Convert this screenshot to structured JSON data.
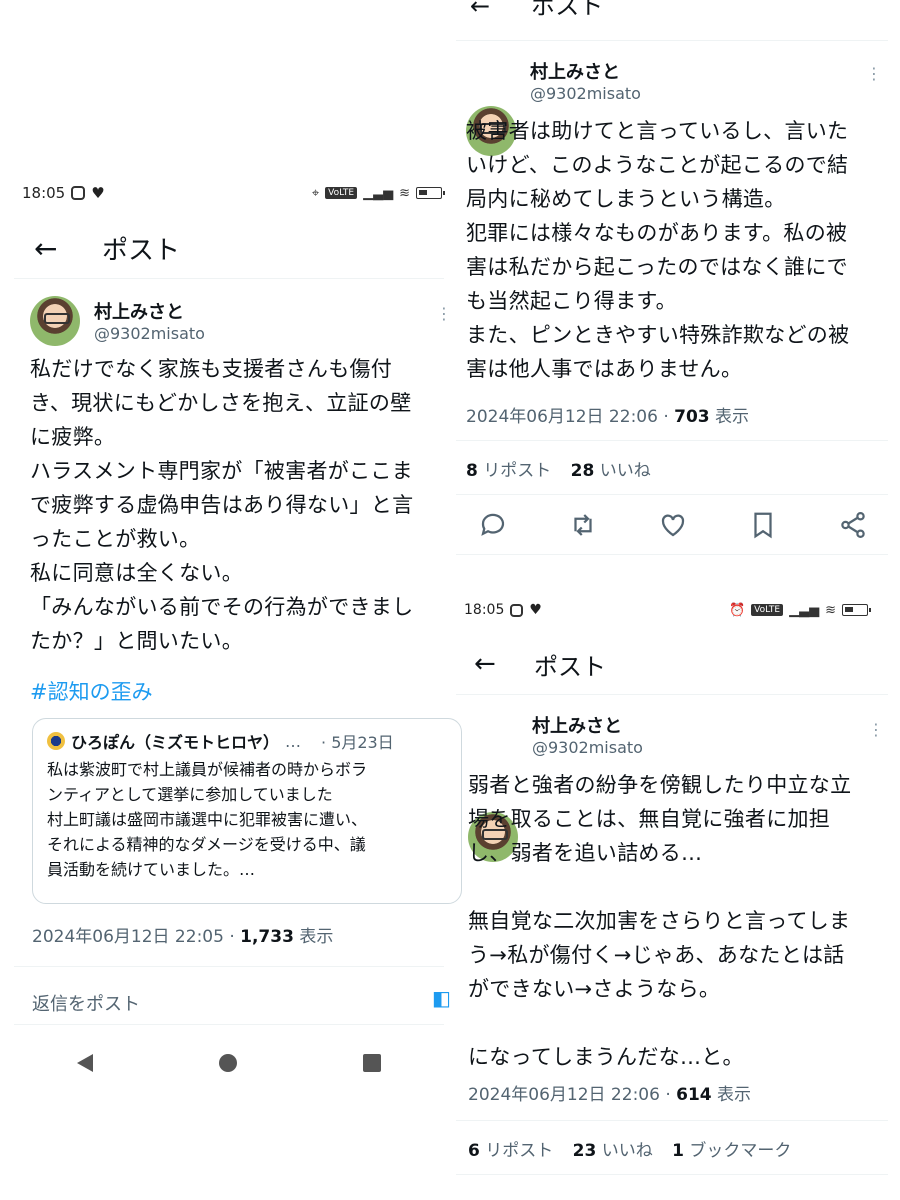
{
  "left": {
    "status": {
      "time": "18:05"
    },
    "header": {
      "title": "ポスト"
    },
    "post": {
      "name": "村上みさと",
      "handle": "@9302misato",
      "lines": [
        "私だけでなく家族も支援者さんも傷付",
        "き、現状にもどかしさを抱え、立証の壁",
        "に疲弊。",
        "ハラスメント専門家が「被害者がここま",
        "で疲弊する虚偽申告はあり得ない」と言",
        "ったことが救い。",
        "私に同意は全くない。",
        "「みんながいる前でその行為ができまし",
        "たか？」と問いたい。"
      ],
      "hashtag": "#認知の歪み",
      "quote": {
        "name": "ひろぽん（ミズモトヒロヤ）",
        "ellipsis": "…",
        "date": "· 5月23日",
        "lines": [
          "私は紫波町で村上議員が候補者の時からボラ",
          "ンティアとして選挙に参加していました",
          "村上町議は盛岡市議選中に犯罪被害に遭い、",
          "それによる精神的なダメージを受ける中、議",
          "員活動を続けていました。…"
        ]
      },
      "timestamp": "2024年06月12日 22:05 · ",
      "views": "1,733",
      "views_label": " 表示"
    },
    "reply_placeholder": "返信をポスト"
  },
  "right_top": {
    "header_partial": "ポスト",
    "post": {
      "name": "村上みさと",
      "handle": "@9302misato",
      "lines": [
        "被害者は助けてと言っているし、言いた",
        "いけど、このようなことが起こるので結",
        "局内に秘めてしまうという構造。",
        "犯罪には様々なものがあります。私の被",
        "害は私だから起こったのではなく誰にで",
        "も当然起こり得ます。",
        "また、ピンときやすい特殊詐欺などの被",
        "害は他人事ではありません。"
      ],
      "timestamp": "2024年06月12日 22:06 · ",
      "views": "703",
      "views_label": " 表示",
      "reposts": "8",
      "reposts_label": " リポスト",
      "likes": "28",
      "likes_label": " いいね"
    }
  },
  "right_bottom": {
    "status": {
      "time": "18:05"
    },
    "header": {
      "title": "ポスト"
    },
    "post": {
      "name": "村上みさと",
      "handle": "@9302misato",
      "lines": [
        "弱者と強者の紛争を傍観したり中立な立",
        "場を取ることは、無自覚に強者に加担",
        "し、弱者を追い詰める…",
        "",
        "無自覚な二次加害をさらりと言ってしま",
        "う→私が傷付く→じゃあ、あなたとは話",
        "ができない→さようなら。",
        "",
        "になってしまうんだな…と。"
      ],
      "timestamp": "2024年06月12日 22:06 · ",
      "views": "614",
      "views_label": " 表示",
      "reposts": "6",
      "reposts_label": " リポスト",
      "likes": "23",
      "likes_label": " いいね",
      "bookmarks": "1",
      "bookmarks_label": " ブックマーク"
    }
  },
  "colors": {
    "link": "#1d9bf0",
    "muted": "#536471",
    "divider": "#eff3f4"
  }
}
